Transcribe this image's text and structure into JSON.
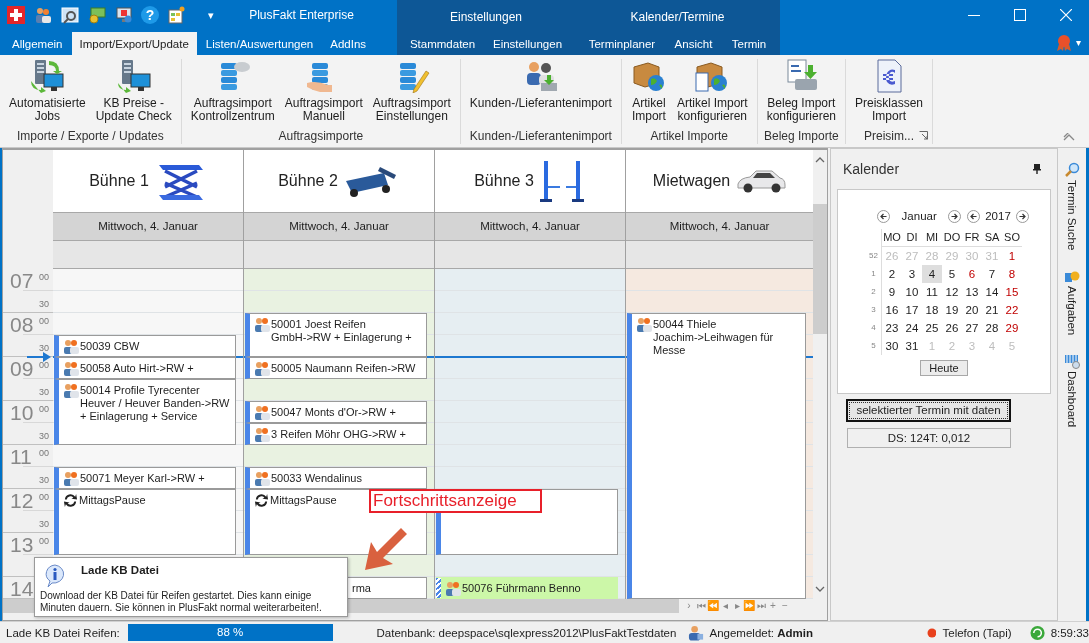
{
  "title_bar": {
    "quick_access": [
      {
        "kind": "flag"
      },
      {
        "kind": "people"
      },
      {
        "kind": "search"
      },
      {
        "kind": "money"
      },
      {
        "kind": "monitor"
      },
      {
        "kind": "help",
        "glyph": "?"
      },
      {
        "kind": "table"
      },
      {
        "kind": "dropdown",
        "glyph": "▾"
      }
    ],
    "title": "PlusFakt Enterprise"
  },
  "tabs": [
    {
      "label": "Allgemein",
      "selected": false
    },
    {
      "label": "Import/Export/Update",
      "selected": true
    },
    {
      "label": "Listen/Auswertungen",
      "selected": false
    },
    {
      "label": "AddIns",
      "selected": false
    }
  ],
  "context_groups": [
    {
      "label": "Einstellungen",
      "tabs": [
        {
          "label": "Stammdaten",
          "selected": false
        },
        {
          "label": "Einstellungen",
          "selected": false
        }
      ]
    },
    {
      "label": "Kalender/Termine",
      "tabs": [
        {
          "label": "Terminplaner",
          "selected": false
        },
        {
          "label": "Ansicht",
          "selected": false
        },
        {
          "label": "Termin",
          "selected": false
        }
      ]
    }
  ],
  "account_menu": {
    "glyph": "▾"
  },
  "ribbon": {
    "groups": [
      {
        "label": "Importe / Exporte / Updates",
        "launcher": false,
        "buttons": [
          {
            "lines": [
              "Automatisierte",
              "Jobs"
            ]
          },
          {
            "lines": [
              "KB Preise -",
              "Update Check"
            ]
          }
        ]
      },
      {
        "label": "Auftragsimporte",
        "launcher": false,
        "buttons": [
          {
            "lines": [
              "Auftragsimport",
              "Kontrollzentrum"
            ]
          },
          {
            "lines": [
              "Auftragsimport",
              "Manuell"
            ]
          },
          {
            "lines": [
              "Auftragsimport",
              "Einstellungen"
            ]
          }
        ]
      },
      {
        "label": "Kunden-/Lieferantenimport",
        "launcher": false,
        "buttons": [
          {
            "lines": [
              "Kunden-/Lieferantenimport"
            ]
          }
        ]
      },
      {
        "label": "Artikel Importe",
        "launcher": false,
        "buttons": [
          {
            "lines": [
              "Artikel",
              "Import"
            ]
          },
          {
            "lines": [
              "Artikel Import",
              "konfigurieren"
            ]
          }
        ]
      },
      {
        "label": "Beleg Importe",
        "launcher": false,
        "buttons": [
          {
            "lines": [
              "Beleg Import",
              "konfigurieren"
            ]
          }
        ]
      },
      {
        "label": "Preisim...",
        "launcher": true,
        "buttons": [
          {
            "lines": [
              "Preisklassen",
              "Import"
            ]
          }
        ]
      }
    ]
  },
  "scheduler": {
    "hours": [
      {
        "hour": "07",
        "minutes": [
          "00",
          "30"
        ]
      },
      {
        "hour": "08",
        "minutes": [
          "00",
          "30"
        ]
      },
      {
        "hour": "09",
        "minutes": [
          "00",
          "30"
        ]
      },
      {
        "hour": "10",
        "minutes": [
          "00",
          "30"
        ]
      },
      {
        "hour": "11",
        "minutes": [
          "00",
          "30"
        ]
      },
      {
        "hour": "12",
        "minutes": [
          "00",
          "30"
        ]
      },
      {
        "hour": "13",
        "minutes": [
          "00"
        ]
      },
      {
        "hour": "14"
      }
    ],
    "resources": [
      {
        "name": "Bühne 1",
        "date": "Mittwoch, 4. Januar",
        "color": "#f7f7f7",
        "appointments": [
          {
            "kind": "customer",
            "text": "50039 CBW",
            "color": "#ffffff",
            "tentative": false
          },
          {
            "kind": "customer",
            "text": "50058 Auto Hirt->RW +",
            "color": "#ffffff",
            "tentative": false
          },
          {
            "kind": "customer",
            "text": "50014 Profile Tyrecenter Heuver /  Heuver Banden->RW + Einlagerung + Service",
            "color": "#ffffff",
            "tentative": false
          },
          {
            "kind": "customer",
            "text": "50071 Meyer Karl->RW +",
            "color": "#ffffff",
            "tentative": false
          },
          {
            "kind": "pause",
            "text": "MittagsPause",
            "color": "#ffffff",
            "tentative": false
          }
        ]
      },
      {
        "name": "Bühne 2",
        "date": "Mittwoch, 4. Januar",
        "color": "#e9f2e1",
        "appointments": [
          {
            "kind": "customer",
            "text": "50001 Joest Reifen GmbH->RW + Einlagerung +",
            "color": "#ffffff",
            "tentative": false
          },
          {
            "kind": "customer",
            "text": "50005 Naumann Reifen->RW",
            "color": "#ffffff",
            "tentative": false
          },
          {
            "kind": "customer",
            "text": "50047 Monts d'Or->RW +",
            "color": "#ffffff",
            "tentative": false
          },
          {
            "kind": "customer",
            "text": "3 Reifen Möhr OHG->RW +",
            "color": "#ffffff",
            "tentative": false
          },
          {
            "kind": "customer",
            "text": "50033 Wendalinus",
            "color": "#ffffff",
            "tentative": false
          },
          {
            "kind": "pause",
            "text": "MittagsPause",
            "color": "#ffffff",
            "tentative": false
          },
          {
            "kind": "covered",
            "text": "rma",
            "color": "#ffffff",
            "tentative": false
          }
        ]
      },
      {
        "name": "Bühne 3",
        "date": "Mittwoch, 4. Januar",
        "color": "#e6eef2",
        "appointments": [
          {
            "kind": "empty",
            "color": "#ffffff",
            "tentative": false
          },
          {
            "kind": "customer",
            "text": "50076 Führmann Benno",
            "color": "#ccf7a8",
            "tentative": true
          }
        ]
      },
      {
        "name": "Mietwagen",
        "date": "Mittwoch, 4. Januar",
        "color": "#f5e9e0",
        "appointments": [
          {
            "kind": "customer",
            "text": "50044 Thiele Joachim->Leihwagen für Messe",
            "color": "#ffffff",
            "tentative": false
          }
        ]
      }
    ],
    "navigation": [
      "›",
      "⏮",
      "⏪",
      "◂",
      "▸",
      "⏩",
      "⏭",
      "+",
      "−"
    ]
  },
  "annotation": {
    "label": "Fortschrittsanzeige"
  },
  "popup": {
    "title": "Lade KB Datei",
    "message": "Download der KB Datei für Reifen gestartet. Dies kann einige Minuten dauern. Sie können in PlusFakt normal weiterarbeiten!."
  },
  "calendar_panel": {
    "title": "Kalender",
    "month": "Januar",
    "year": "2017",
    "weekdays": [
      "MO",
      "DI",
      "MI",
      "DO",
      "FR",
      "SA",
      "SO"
    ],
    "weeks": [
      {
        "number": "52",
        "days": [
          {
            "d": "26",
            "kind": "other",
            "selected": false
          },
          {
            "d": "27",
            "kind": "other",
            "selected": false
          },
          {
            "d": "28",
            "kind": "other",
            "selected": false
          },
          {
            "d": "29",
            "kind": "other",
            "selected": false
          },
          {
            "d": "30",
            "kind": "other",
            "selected": false
          },
          {
            "d": "31",
            "kind": "other",
            "selected": false
          },
          {
            "d": "1",
            "kind": "holiday",
            "selected": false
          }
        ]
      },
      {
        "number": "1",
        "days": [
          {
            "d": "2",
            "kind": "normal",
            "selected": false
          },
          {
            "d": "3",
            "kind": "normal",
            "selected": false
          },
          {
            "d": "4",
            "kind": "normal",
            "selected": true
          },
          {
            "d": "5",
            "kind": "normal",
            "selected": false
          },
          {
            "d": "6",
            "kind": "holiday",
            "selected": false
          },
          {
            "d": "7",
            "kind": "normal",
            "selected": false
          },
          {
            "d": "8",
            "kind": "holiday",
            "selected": false
          }
        ]
      },
      {
        "number": "2",
        "days": [
          {
            "d": "9",
            "kind": "normal",
            "selected": false
          },
          {
            "d": "10",
            "kind": "normal",
            "selected": false
          },
          {
            "d": "11",
            "kind": "normal",
            "selected": false
          },
          {
            "d": "12",
            "kind": "normal",
            "selected": false
          },
          {
            "d": "13",
            "kind": "normal",
            "selected": false
          },
          {
            "d": "14",
            "kind": "normal",
            "selected": false
          },
          {
            "d": "15",
            "kind": "holiday",
            "selected": false
          }
        ]
      },
      {
        "number": "3",
        "days": [
          {
            "d": "16",
            "kind": "normal",
            "selected": false
          },
          {
            "d": "17",
            "kind": "normal",
            "selected": false
          },
          {
            "d": "18",
            "kind": "normal",
            "selected": false
          },
          {
            "d": "19",
            "kind": "normal",
            "selected": false
          },
          {
            "d": "20",
            "kind": "normal",
            "selected": false
          },
          {
            "d": "21",
            "kind": "normal",
            "selected": false
          },
          {
            "d": "22",
            "kind": "holiday",
            "selected": false
          }
        ]
      },
      {
        "number": "4",
        "days": [
          {
            "d": "23",
            "kind": "normal",
            "selected": false
          },
          {
            "d": "24",
            "kind": "normal",
            "selected": false
          },
          {
            "d": "25",
            "kind": "normal",
            "selected": false
          },
          {
            "d": "26",
            "kind": "normal",
            "selected": false
          },
          {
            "d": "27",
            "kind": "normal",
            "selected": false
          },
          {
            "d": "28",
            "kind": "normal",
            "selected": false
          },
          {
            "d": "29",
            "kind": "holiday",
            "selected": false
          }
        ]
      },
      {
        "number": "5",
        "days": [
          {
            "d": "30",
            "kind": "normal",
            "selected": false
          },
          {
            "d": "31",
            "kind": "normal",
            "selected": false
          },
          {
            "d": "1",
            "kind": "other",
            "selected": false
          },
          {
            "d": "2",
            "kind": "other",
            "selected": false
          },
          {
            "d": "3",
            "kind": "other",
            "selected": false
          },
          {
            "d": "4",
            "kind": "other",
            "selected": false
          },
          {
            "d": "5",
            "kind": "other",
            "selected": false
          }
        ]
      }
    ],
    "today_button": "Heute",
    "action_button": "selektierter Termin mit daten",
    "info": "DS: 124T: 0,012"
  },
  "side_tabs": [
    {
      "label": "Termin Suche"
    },
    {
      "label": "Aufgaben"
    },
    {
      "label": "Dashboard"
    }
  ],
  "status_bar": {
    "progress_label": "Lade KB Datei Reifen:",
    "progress": {
      "level": 1,
      "text": "88 %"
    },
    "database": "Datenbank: deepspace\\sqlexpress2012\\PlusFaktTestdaten",
    "user": "Angemeldet: **Admin**",
    "phone": "Telefon (Tapi)",
    "time": "8:59:33"
  }
}
